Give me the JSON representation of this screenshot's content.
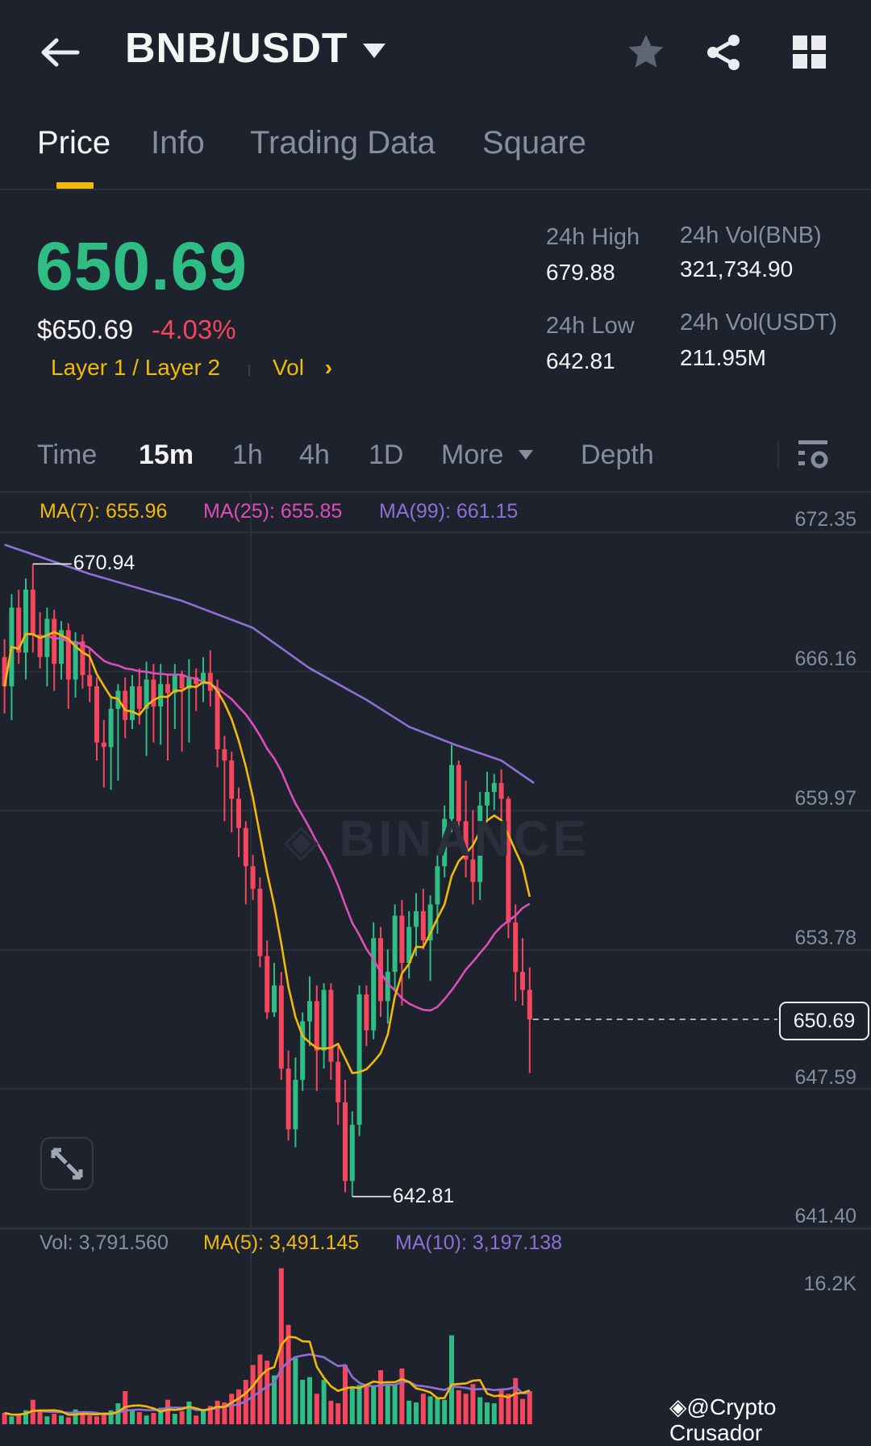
{
  "header": {
    "title": "BNB/USDT",
    "icons": [
      "back-arrow-icon",
      "dropdown-caret-icon",
      "star-icon",
      "share-icon",
      "grid-icon"
    ]
  },
  "tabs": [
    {
      "label": "Price",
      "active": true
    },
    {
      "label": "Info"
    },
    {
      "label": "Trading Data"
    },
    {
      "label": "Square"
    }
  ],
  "ticker": {
    "last_price": "650.69",
    "fiat_price": "$650.69",
    "change_pct": "-4.03%",
    "tag": "Layer 1 / Layer 2",
    "vol_link": "Vol",
    "high_label": "24h High",
    "high": "679.88",
    "low_label": "24h Low",
    "low": "642.81",
    "vol_base_label": "24h Vol(BNB)",
    "vol_base": "321,734.90",
    "vol_quote_label": "24h Vol(USDT)",
    "vol_quote": "211.95M"
  },
  "timeframes": {
    "items": [
      "Time",
      "15m",
      "1h",
      "4h",
      "1D",
      "More"
    ],
    "active": "15m",
    "depth": "Depth"
  },
  "colors": {
    "up": "#2ebd85",
    "down": "#f6465d",
    "accent": "#f0b90b",
    "ma7": "#f0b90b",
    "ma25": "#d94fb8",
    "ma99": "#8e6fd6",
    "bg": "#1e222d",
    "grid": "#2b3139"
  },
  "chart_data": {
    "type": "candlestick",
    "interval": "15m",
    "ma_legend": {
      "ma7": "MA(7): 655.96",
      "ma25": "MA(25): 655.85",
      "ma99": "MA(99): 661.15"
    },
    "y_ticks": [
      "672.35",
      "666.16",
      "659.97",
      "653.78",
      "647.59",
      "641.40"
    ],
    "ylim": [
      641.4,
      672.35
    ],
    "current_price": "650.69",
    "high_marker": "670.94",
    "low_marker": "642.81",
    "ohlc": [
      [
        666.8,
        667.6,
        664.3,
        665.5
      ],
      [
        665.5,
        669.6,
        664.0,
        669.0
      ],
      [
        669.0,
        669.8,
        666.5,
        667.0
      ],
      [
        667.0,
        670.3,
        665.8,
        669.8
      ],
      [
        669.8,
        670.94,
        667.0,
        667.8
      ],
      [
        667.8,
        668.8,
        666.3,
        666.8
      ],
      [
        666.8,
        669.0,
        665.5,
        668.5
      ],
      [
        668.5,
        668.9,
        665.3,
        666.5
      ],
      [
        666.5,
        668.4,
        665.8,
        668.0
      ],
      [
        668.0,
        668.3,
        664.5,
        665.8
      ],
      [
        665.8,
        667.9,
        665.0,
        667.5
      ],
      [
        667.5,
        667.8,
        665.4,
        666.0
      ],
      [
        666.0,
        667.2,
        664.8,
        665.5
      ],
      [
        665.5,
        665.9,
        662.2,
        663.0
      ],
      [
        663.0,
        664.0,
        661.0,
        662.8
      ],
      [
        662.8,
        665.0,
        660.9,
        664.5
      ],
      [
        664.5,
        665.6,
        661.3,
        665.3
      ],
      [
        665.3,
        665.9,
        663.2,
        664.0
      ],
      [
        664.0,
        666.0,
        663.6,
        665.5
      ],
      [
        665.5,
        666.3,
        663.8,
        664.5
      ],
      [
        664.5,
        666.6,
        662.4,
        665.8
      ],
      [
        665.8,
        666.5,
        663.0,
        664.6
      ],
      [
        664.6,
        666.5,
        662.9,
        665.6
      ],
      [
        665.6,
        666.0,
        662.2,
        665.2
      ],
      [
        665.2,
        666.5,
        663.6,
        666.0
      ],
      [
        666.0,
        666.2,
        662.6,
        665.4
      ],
      [
        665.4,
        666.7,
        663.0,
        665.9
      ],
      [
        665.9,
        666.3,
        664.4,
        665.6
      ],
      [
        665.6,
        666.8,
        664.8,
        666.1
      ],
      [
        666.1,
        667.1,
        664.6,
        665.3
      ],
      [
        665.3,
        665.8,
        661.9,
        662.7
      ],
      [
        662.7,
        663.3,
        659.5,
        662.2
      ],
      [
        662.2,
        662.6,
        659.0,
        660.5
      ],
      [
        660.5,
        661.0,
        657.9,
        659.2
      ],
      [
        659.2,
        659.5,
        655.8,
        657.5
      ],
      [
        657.5,
        658.0,
        656.0,
        656.5
      ],
      [
        656.5,
        657.0,
        653.0,
        653.5
      ],
      [
        653.5,
        654.2,
        650.7,
        651.0
      ],
      [
        651.0,
        653.2,
        650.8,
        652.2
      ],
      [
        652.2,
        652.8,
        648.0,
        648.5
      ],
      [
        648.5,
        649.3,
        645.3,
        645.8
      ],
      [
        645.8,
        649.0,
        645.0,
        648.0
      ],
      [
        648.0,
        651.0,
        647.5,
        650.6
      ],
      [
        650.6,
        652.6,
        649.5,
        651.5
      ],
      [
        651.5,
        652.2,
        647.5,
        649.3
      ],
      [
        649.3,
        652.3,
        648.5,
        652.0
      ],
      [
        652.0,
        652.3,
        648.0,
        648.8
      ],
      [
        648.8,
        649.5,
        646.0,
        647.0
      ],
      [
        647.0,
        648.0,
        643.0,
        643.5
      ],
      [
        643.5,
        646.6,
        642.81,
        646.0
      ],
      [
        646.0,
        652.2,
        645.5,
        651.8
      ],
      [
        651.8,
        652.2,
        649.5,
        650.2
      ],
      [
        650.2,
        655.0,
        649.8,
        654.3
      ],
      [
        654.3,
        654.8,
        650.8,
        651.5
      ],
      [
        651.5,
        653.8,
        650.5,
        652.8
      ],
      [
        652.8,
        655.8,
        652.0,
        655.3
      ],
      [
        655.3,
        656.0,
        651.3,
        653.2
      ],
      [
        653.2,
        655.5,
        652.5,
        654.8
      ],
      [
        654.8,
        656.3,
        653.5,
        655.5
      ],
      [
        655.5,
        656.5,
        653.8,
        654.2
      ],
      [
        654.2,
        656.2,
        652.4,
        655.8
      ],
      [
        655.8,
        658.0,
        654.5,
        657.5
      ],
      [
        657.5,
        660.2,
        657.0,
        659.6
      ],
      [
        659.6,
        662.9,
        659.0,
        662.0
      ],
      [
        662.0,
        662.2,
        659.0,
        659.5
      ],
      [
        659.5,
        661.3,
        657.0,
        657.8
      ],
      [
        657.8,
        660.0,
        655.8,
        656.8
      ],
      [
        656.8,
        660.8,
        656.0,
        660.2
      ],
      [
        660.2,
        661.7,
        659.5,
        660.8
      ],
      [
        660.8,
        661.6,
        660.0,
        661.2
      ],
      [
        661.2,
        661.8,
        659.6,
        660.5
      ],
      [
        660.5,
        660.6,
        654.3,
        655.0
      ],
      [
        655.0,
        655.8,
        651.5,
        652.8
      ],
      [
        652.8,
        654.3,
        651.3,
        652.0
      ],
      [
        652.0,
        653.0,
        648.3,
        650.69
      ]
    ],
    "ma99_points": [
      [
        0,
        671.8
      ],
      [
        12,
        670.5
      ],
      [
        25,
        669.3
      ],
      [
        35,
        668.1
      ],
      [
        43,
        666.3
      ],
      [
        51,
        664.9
      ],
      [
        57,
        663.7
      ],
      [
        63.5,
        662.9
      ],
      [
        70,
        662.2
      ],
      [
        74.6,
        661.2
      ]
    ],
    "volume": {
      "legend": {
        "vol": "Vol: 3,791.560",
        "ma5": "MA(5): 3,491.145",
        "ma10": "MA(10): 3,197.138"
      },
      "y_tick": "16.2K",
      "unit": "K",
      "values": [
        1.3,
        0.9,
        1.1,
        1.6,
        2.8,
        1.5,
        0.9,
        1.2,
        1.0,
        0.8,
        1.7,
        1.3,
        1.0,
        0.9,
        1.2,
        1.6,
        2.4,
        3.8,
        1.6,
        1.4,
        1.0,
        1.3,
        1.9,
        2.8,
        1.2,
        1.5,
        2.6,
        1.0,
        1.6,
        2.1,
        2.7,
        2.5,
        3.5,
        4.0,
        5.1,
        6.8,
        8.0,
        7.3,
        5.6,
        17.9,
        11.4,
        7.6,
        5.1,
        5.4,
        3.5,
        5.1,
        2.7,
        2.4,
        6.8,
        4.3,
        4.5,
        4.6,
        4.3,
        6.2,
        4.5,
        4.5,
        6.4,
        2.7,
        2.5,
        3.5,
        3.2,
        3.0,
        2.8,
        10.2,
        3.9,
        3.5,
        4.6,
        3.1,
        2.5,
        2.4,
        3.9,
        3.5,
        5.3,
        2.9,
        3.79
      ]
    }
  },
  "watermark": {
    "chart": "BINANCE",
    "credit": "@Crypto Crusador"
  }
}
